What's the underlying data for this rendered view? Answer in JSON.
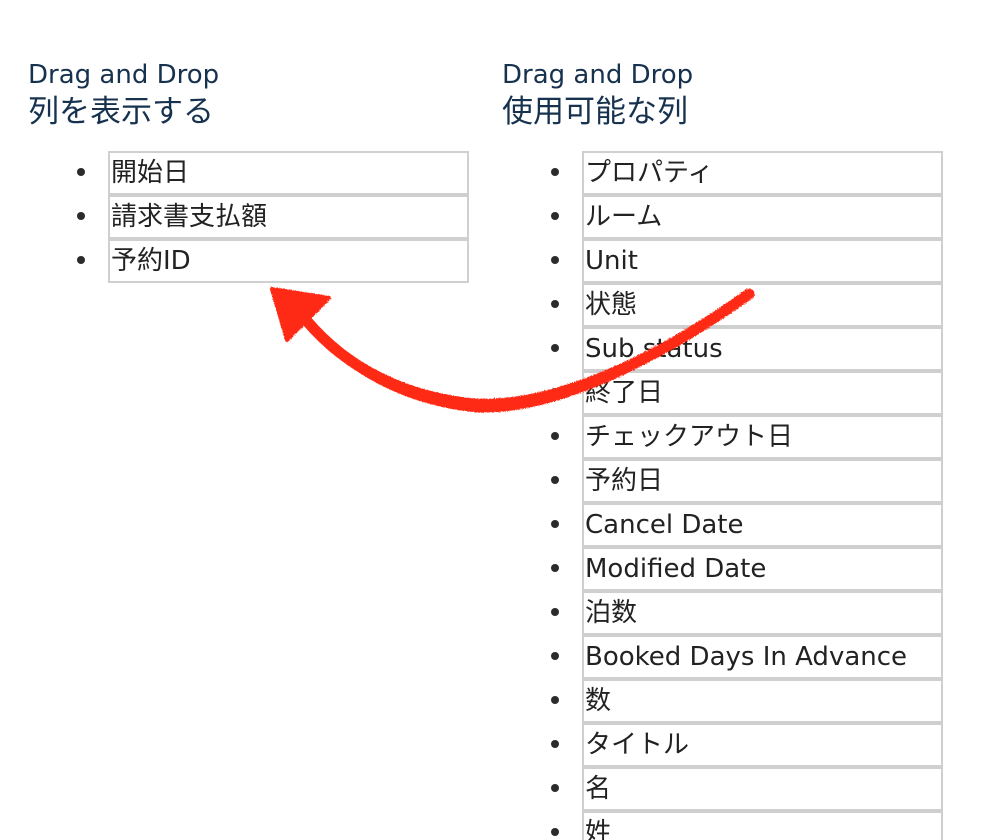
{
  "left": {
    "subtitle": "Drag and Drop",
    "title": "列を表示する",
    "items": [
      "開始日",
      "請求書支払額",
      "予約ID"
    ]
  },
  "right": {
    "subtitle": "Drag and Drop",
    "title": "使用可能な列",
    "items": [
      "プロパティ",
      "ルーム",
      "Unit",
      "状態",
      "Sub status",
      "終了日",
      "チェックアウト日",
      "予約日",
      "Cancel Date",
      "Modified Date",
      "泊数",
      "Booked Days In Advance",
      "数",
      "タイトル",
      "名",
      "姓"
    ]
  },
  "annotation": {
    "icon": "curved-arrow-icon",
    "color": "#ff2a12"
  }
}
